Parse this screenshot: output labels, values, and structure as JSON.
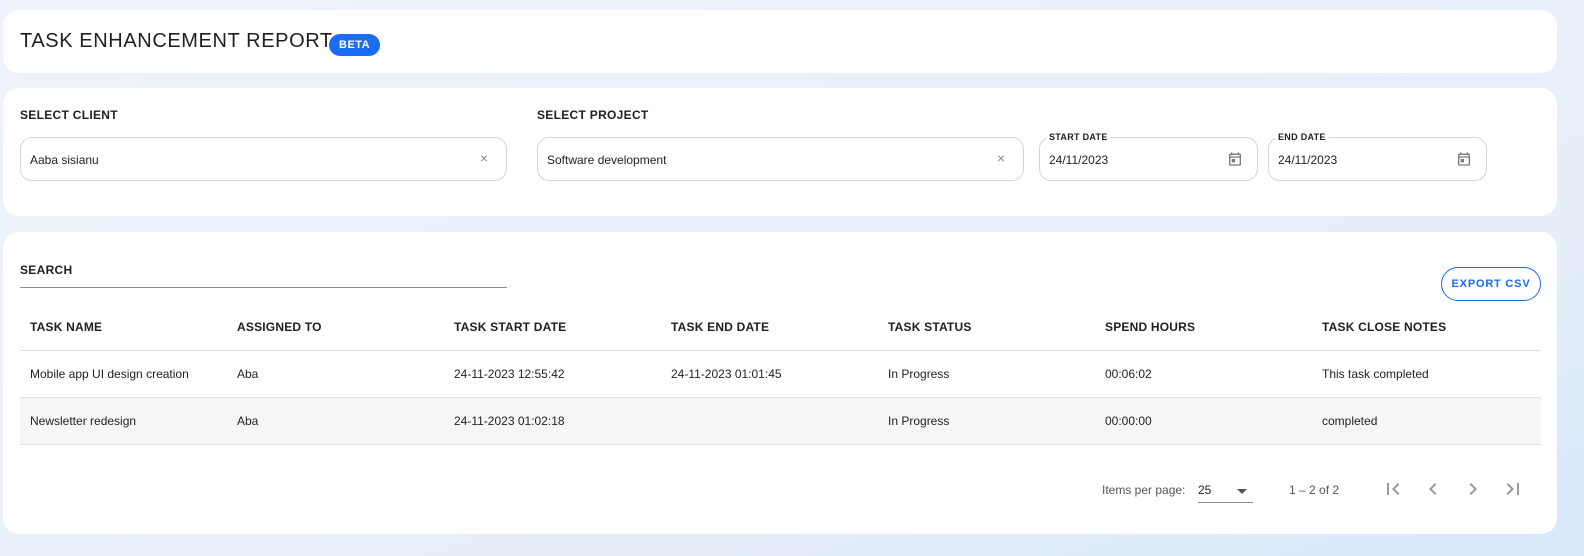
{
  "header": {
    "title": "TASK ENHANCEMENT REPORT",
    "badge": "BETA"
  },
  "filters": {
    "client_label": "SELECT CLIENT",
    "client_value": "Aaba sisianu",
    "project_label": "SELECT PROJECT",
    "project_value": "Software development",
    "start_date_label": "START DATE",
    "start_date_value": "24/11/2023",
    "end_date_label": "END DATE",
    "end_date_value": "24/11/2023",
    "clear_icon": "close-icon",
    "calendar_icon": "calendar-icon"
  },
  "search": {
    "label": "SEARCH",
    "value": ""
  },
  "export_label": "EXPORT CSV",
  "table": {
    "columns": [
      "TASK NAME",
      "ASSIGNED TO",
      "TASK START DATE",
      "TASK END DATE",
      "TASK STATUS",
      "SPEND HOURS",
      "TASK CLOSE NOTES"
    ],
    "rows": [
      [
        "Mobile app UI design creation",
        "Aba",
        "24-11-2023 12:55:42",
        "24-11-2023 01:01:45",
        "In Progress",
        "00:06:02",
        "This task completed"
      ],
      [
        "Newsletter redesign",
        "Aba",
        "24-11-2023 01:02:18",
        "",
        "In Progress",
        "00:00:00",
        "completed"
      ]
    ]
  },
  "paginator": {
    "items_per_page_label": "Items per page:",
    "items_per_page_value": "25",
    "range_label": "1 – 2 of 2"
  },
  "colors": {
    "accent": "#1a6cf0",
    "row_alt": "#f6f6f6"
  }
}
